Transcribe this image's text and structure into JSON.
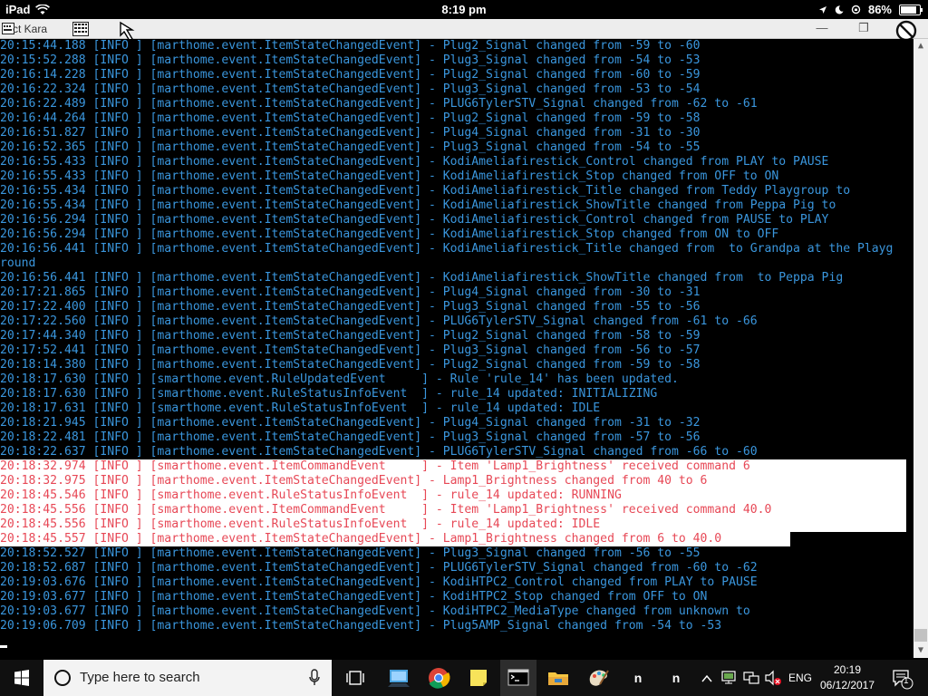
{
  "ios_status": {
    "device": "iPad",
    "time": "8:19 pm",
    "battery": "86%",
    "battery_level": 0.86
  },
  "window": {
    "title": "ct Kara",
    "minimize": "—",
    "restore": "❐",
    "close": "✕"
  },
  "console": {
    "highlight_rows": [
      29,
      30,
      31,
      32,
      33,
      34
    ],
    "lines": [
      "20:15:44.188 [INFO ] [marthome.event.ItemStateChangedEvent] - Plug2_Signal changed from -59 to -60",
      "20:15:52.288 [INFO ] [marthome.event.ItemStateChangedEvent] - Plug3_Signal changed from -54 to -53",
      "20:16:14.228 [INFO ] [marthome.event.ItemStateChangedEvent] - Plug2_Signal changed from -60 to -59",
      "20:16:22.324 [INFO ] [marthome.event.ItemStateChangedEvent] - Plug3_Signal changed from -53 to -54",
      "20:16:22.489 [INFO ] [marthome.event.ItemStateChangedEvent] - PLUG6TylerSTV_Signal changed from -62 to -61",
      "20:16:44.264 [INFO ] [marthome.event.ItemStateChangedEvent] - Plug2_Signal changed from -59 to -58",
      "20:16:51.827 [INFO ] [marthome.event.ItemStateChangedEvent] - Plug4_Signal changed from -31 to -30",
      "20:16:52.365 [INFO ] [marthome.event.ItemStateChangedEvent] - Plug3_Signal changed from -54 to -55",
      "20:16:55.433 [INFO ] [marthome.event.ItemStateChangedEvent] - KodiAmeliafirestick_Control changed from PLAY to PAUSE",
      "20:16:55.433 [INFO ] [marthome.event.ItemStateChangedEvent] - KodiAmeliafirestick_Stop changed from OFF to ON",
      "20:16:55.434 [INFO ] [marthome.event.ItemStateChangedEvent] - KodiAmeliafirestick_Title changed from Teddy Playgroup to",
      "20:16:55.434 [INFO ] [marthome.event.ItemStateChangedEvent] - KodiAmeliafirestick_ShowTitle changed from Peppa Pig to",
      "20:16:56.294 [INFO ] [marthome.event.ItemStateChangedEvent] - KodiAmeliafirestick_Control changed from PAUSE to PLAY",
      "20:16:56.294 [INFO ] [marthome.event.ItemStateChangedEvent] - KodiAmeliafirestick_Stop changed from ON to OFF",
      "20:16:56.441 [INFO ] [marthome.event.ItemStateChangedEvent] - KodiAmeliafirestick_Title changed from  to Grandpa at the Playg",
      "round",
      "20:16:56.441 [INFO ] [marthome.event.ItemStateChangedEvent] - KodiAmeliafirestick_ShowTitle changed from  to Peppa Pig",
      "20:17:21.865 [INFO ] [marthome.event.ItemStateChangedEvent] - Plug4_Signal changed from -30 to -31",
      "20:17:22.400 [INFO ] [marthome.event.ItemStateChangedEvent] - Plug3_Signal changed from -55 to -56",
      "20:17:22.560 [INFO ] [marthome.event.ItemStateChangedEvent] - PLUG6TylerSTV_Signal changed from -61 to -66",
      "20:17:44.340 [INFO ] [marthome.event.ItemStateChangedEvent] - Plug2_Signal changed from -58 to -59",
      "20:17:52.441 [INFO ] [marthome.event.ItemStateChangedEvent] - Plug3_Signal changed from -56 to -57",
      "20:18:14.380 [INFO ] [marthome.event.ItemStateChangedEvent] - Plug2_Signal changed from -59 to -58",
      "20:18:17.630 [INFO ] [smarthome.event.RuleUpdatedEvent     ] - Rule 'rule_14' has been updated.",
      "20:18:17.630 [INFO ] [smarthome.event.RuleStatusInfoEvent  ] - rule_14 updated: INITIALIZING",
      "20:18:17.631 [INFO ] [smarthome.event.RuleStatusInfoEvent  ] - rule_14 updated: IDLE",
      "20:18:21.945 [INFO ] [marthome.event.ItemStateChangedEvent] - Plug4_Signal changed from -31 to -32",
      "20:18:22.481 [INFO ] [marthome.event.ItemStateChangedEvent] - Plug3_Signal changed from -57 to -56",
      "20:18:22.637 [INFO ] [marthome.event.ItemStateChangedEvent] - PLUG6TylerSTV_Signal changed from -66 to -60",
      "20:18:32.974 [INFO ] [smarthome.event.ItemCommandEvent     ] - Item 'Lamp1_Brightness' received command 6",
      "20:18:32.975 [INFO ] [marthome.event.ItemStateChangedEvent] - Lamp1_Brightness changed from 40 to 6",
      "20:18:45.546 [INFO ] [smarthome.event.RuleStatusInfoEvent  ] - rule_14 updated: RUNNING",
      "20:18:45.556 [INFO ] [smarthome.event.ItemCommandEvent     ] - Item 'Lamp1_Brightness' received command 40.0",
      "20:18:45.556 [INFO ] [smarthome.event.RuleStatusInfoEvent  ] - rule_14 updated: IDLE",
      "20:18:45.557 [INFO ] [marthome.event.ItemStateChangedEvent] - Lamp1_Brightness changed from 6 to 40.0",
      "20:18:52.527 [INFO ] [marthome.event.ItemStateChangedEvent] - Plug3_Signal changed from -56 to -55",
      "20:18:52.687 [INFO ] [marthome.event.ItemStateChangedEvent] - PLUG6TylerSTV_Signal changed from -60 to -62",
      "20:19:03.676 [INFO ] [marthome.event.ItemStateChangedEvent] - KodiHTPC2_Control changed from PLAY to PAUSE",
      "20:19:03.677 [INFO ] [marthome.event.ItemStateChangedEvent] - KodiHTPC2_Stop changed from OFF to ON",
      "20:19:03.677 [INFO ] [marthome.event.ItemStateChangedEvent] - KodiHTPC2_MediaType changed from unknown to",
      "20:19:06.709 [INFO ] [marthome.event.ItemStateChangedEvent] - Plug5AMP_Signal changed from -54 to -53"
    ]
  },
  "taskbar": {
    "search_placeholder": "Type here to search",
    "pinned_n1": "n",
    "pinned_n2": "n",
    "language": "ENG",
    "clock_time": "20:19",
    "clock_date": "06/12/2017",
    "notification_count": "1",
    "colors": {
      "taskbar_bg": "#101010",
      "windows_blue": "#0078d7",
      "console_text": "#3a96dd",
      "highlight_text": "#e74856"
    }
  }
}
